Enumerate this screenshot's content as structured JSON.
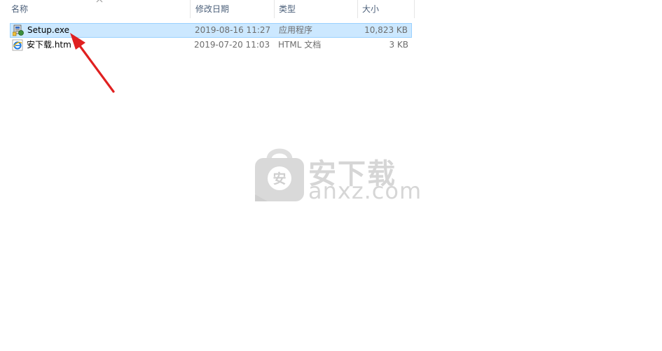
{
  "columns": {
    "name": "名称",
    "modified": "修改日期",
    "type": "类型",
    "size": "大小"
  },
  "files": [
    {
      "name": "Setup.exe",
      "modified": "2019-08-16 11:27",
      "type": "应用程序",
      "size": "10,823 KB",
      "icon": "installer-icon",
      "selected": true
    },
    {
      "name": "安下载.htm",
      "modified": "2019-07-20 11:03",
      "type": "HTML 文档",
      "size": "3 KB",
      "icon": "ie-html-icon",
      "selected": false
    }
  ],
  "watermark": {
    "brand": "安下载",
    "domain": "anxz.com",
    "badge": "安"
  },
  "colors": {
    "selection_bg": "#cce8ff",
    "selection_border": "#99d1ff",
    "annotation_arrow": "#e02020",
    "header_text": "#4c607a"
  }
}
